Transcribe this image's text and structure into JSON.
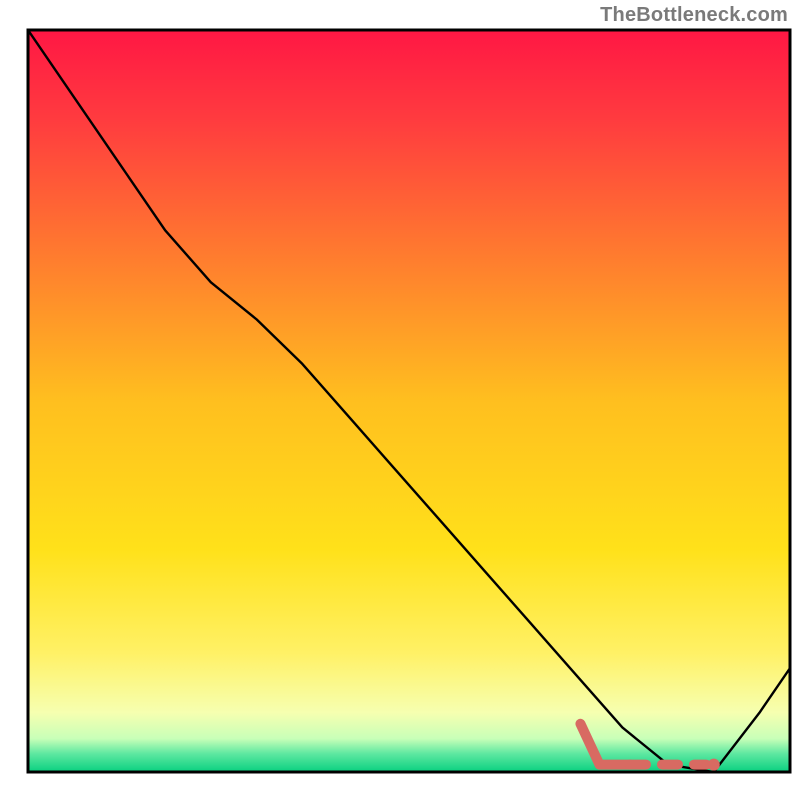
{
  "attribution": "TheBottleneck.com",
  "chart_data": {
    "type": "line",
    "title": "",
    "xlabel": "",
    "ylabel": "",
    "x": [
      0,
      6,
      12,
      18,
      24,
      30,
      36,
      42,
      48,
      54,
      60,
      66,
      72,
      78,
      84,
      90,
      96,
      100
    ],
    "curve_y": [
      100,
      91,
      82,
      73,
      66,
      61,
      55,
      48,
      41,
      34,
      27,
      20,
      13,
      6,
      1,
      0,
      8,
      14
    ],
    "ylim": [
      0,
      100
    ],
    "xlim": [
      0,
      100
    ],
    "dashed_segment": {
      "x_start": 75,
      "x_end": 90,
      "y": 1
    },
    "gradient_stops": [
      {
        "offset": 0.0,
        "color": "#ff1744"
      },
      {
        "offset": 0.12,
        "color": "#ff3b3f"
      },
      {
        "offset": 0.3,
        "color": "#ff7a2f"
      },
      {
        "offset": 0.5,
        "color": "#ffbf1f"
      },
      {
        "offset": 0.7,
        "color": "#ffe11a"
      },
      {
        "offset": 0.84,
        "color": "#fff166"
      },
      {
        "offset": 0.92,
        "color": "#f6ffb0"
      },
      {
        "offset": 0.955,
        "color": "#c8ffb8"
      },
      {
        "offset": 0.975,
        "color": "#5fe8a1"
      },
      {
        "offset": 1.0,
        "color": "#09d080"
      }
    ],
    "frame_color": "#000000",
    "curve_color": "#000000",
    "dash_color": "#d86a62"
  }
}
